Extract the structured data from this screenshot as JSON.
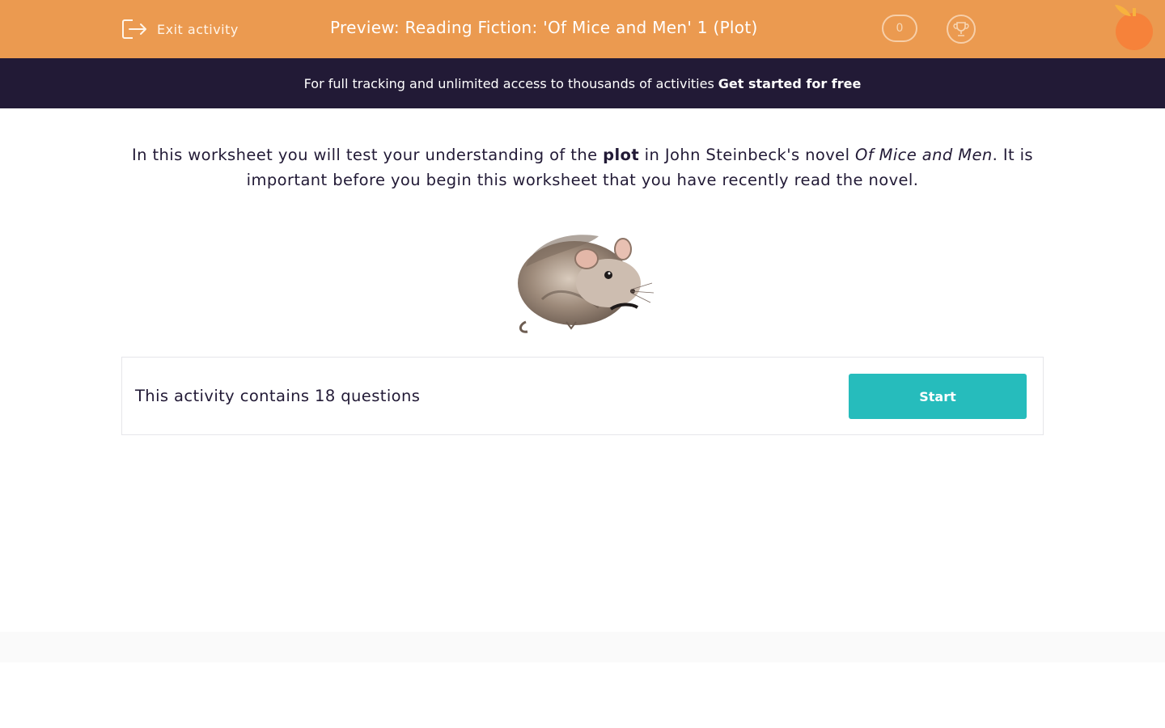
{
  "header": {
    "exit_label": "Exit activity",
    "title": "Preview: Reading Fiction: 'Of Mice and Men' 1 (Plot)",
    "score": "0"
  },
  "banner": {
    "text": "For full tracking and unlimited access to thousands of activities",
    "cta": "Get started for free"
  },
  "intro": {
    "part1": "In this worksheet you will test your understanding of the ",
    "bold": "plot",
    "part2": " in John Steinbeck's novel ",
    "italic": "Of Mice and Men",
    "part3": ". It is important before you begin this worksheet that you have recently read the novel."
  },
  "activity": {
    "count_text": "This activity contains 18 questions",
    "start_label": "Start"
  },
  "colors": {
    "header_bg": "#eb9a50",
    "banner_bg": "#221a36",
    "start_button": "#26bcbc"
  }
}
